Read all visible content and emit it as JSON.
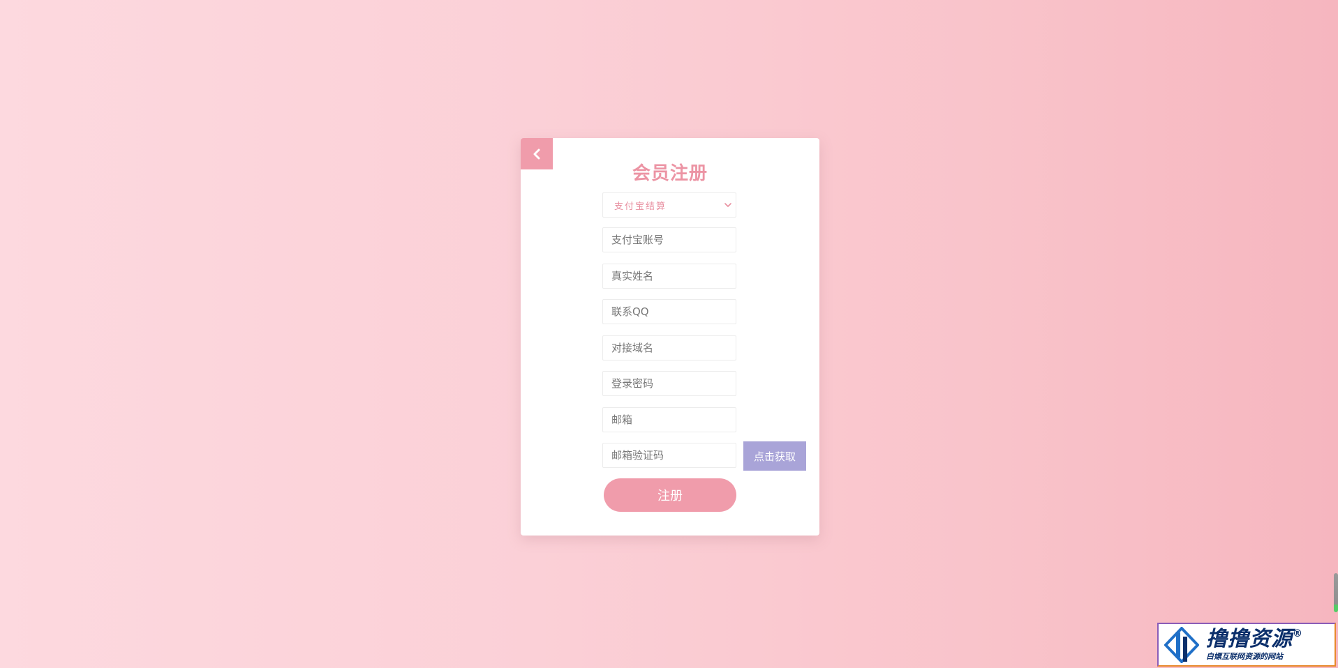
{
  "form": {
    "title": "会员注册",
    "settlement_select": {
      "value": "支付宝结算"
    },
    "fields": {
      "alipay_account": "支付宝账号",
      "real_name": "真实姓名",
      "qq": "联系QQ",
      "domain": "对接域名",
      "password": "登录密码",
      "email": "邮箱",
      "email_code": "邮箱验证码"
    },
    "get_code_label": "点击获取",
    "submit_label": "注册"
  },
  "watermark": {
    "brand": "撸撸资源",
    "registered": "®",
    "tagline": "白嫖互联网资源的网站"
  },
  "colors": {
    "accent_pink": "#f09cab",
    "title_pink": "#ec94a4",
    "code_button": "#a9a4d8",
    "watermark_navy": "#0b2f6b"
  },
  "icons": {
    "back": "chevron-left-icon",
    "select": "chevron-down-icon",
    "logo": "logo-icon"
  }
}
